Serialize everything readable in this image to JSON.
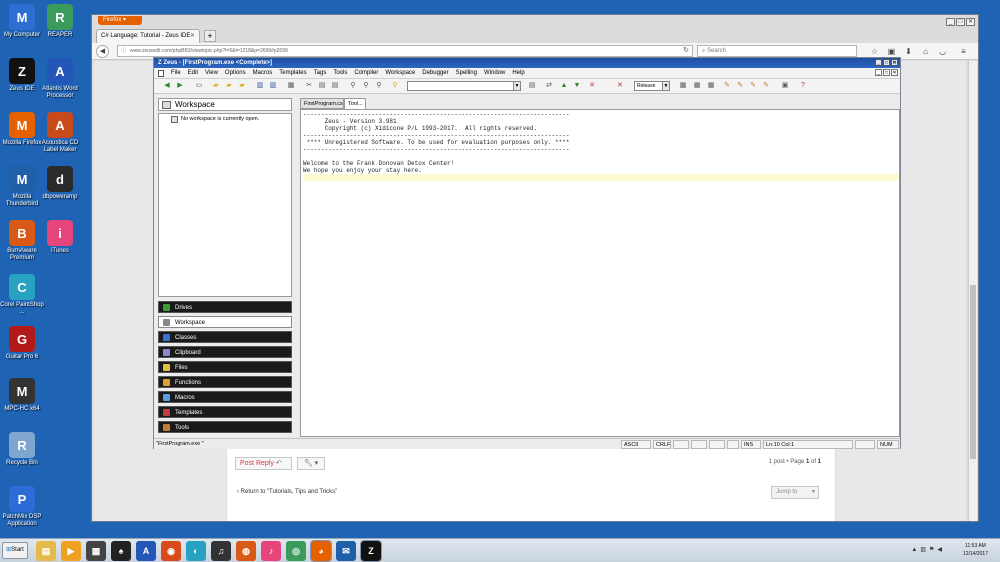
{
  "desktop": {
    "icons": [
      {
        "label": "My Computer",
        "color": "#2a6fd1"
      },
      {
        "label": "REAPER",
        "color": "#3b9b5c"
      },
      {
        "label": "Zeus IDE",
        "color": "#111111"
      },
      {
        "label": "Atlantis Word Processor",
        "color": "#2456b8"
      },
      {
        "label": "Mozilla Firefox",
        "color": "#e66000"
      },
      {
        "label": "Acoustica CD Label Maker",
        "color": "#c84a1a"
      },
      {
        "label": "Mozilla Thunderbird",
        "color": "#1f5fa8"
      },
      {
        "label": "dbpoweramp",
        "color": "#2b2b2b"
      },
      {
        "label": "BurnAware Premium",
        "color": "#d95a17"
      },
      {
        "label": "iTunes",
        "color": "#e5457b"
      },
      {
        "label": "Corel PaintShop ...",
        "color": "#27a3c1"
      },
      {
        "label": "Guitar Pro 6",
        "color": "#b21a1a"
      },
      {
        "label": "MPC-HC x64",
        "color": "#333333"
      },
      {
        "label": "Recycle Bin",
        "color": "#7fa6cf"
      },
      {
        "label": "PatchMix DSP Application",
        "color": "#2c6cd6"
      }
    ]
  },
  "firefox": {
    "menu_button": "Firefox",
    "tab_title": "C# Language: Tutorial - Zeus IDE",
    "new_tab": "+",
    "url": "www.zeusedit.com/phpBB3/viewtopic.php?f=5&t=1218&p=2699#p2699",
    "search_placeholder": "Search",
    "page": {
      "post_reply": "Post Reply",
      "post_count_prefix": "1 post • Page ",
      "page_current": "1",
      "page_sep": " of ",
      "page_total": "1",
      "back_link": "Return to “Tutorials, Tips and Tricks”",
      "jump_to": "Jump to"
    }
  },
  "zeus": {
    "title": "Zeus - [FirstProgram.exe  <Complete>]",
    "menu": [
      "File",
      "Edit",
      "View",
      "Options",
      "Macros",
      "Templates",
      "Tags",
      "Tools",
      "Compiler",
      "Workspace",
      "Debugger",
      "Spelling",
      "Window",
      "Help"
    ],
    "config_combo": "Release",
    "workspace": {
      "header": "Workspace",
      "tree_item": "No workspace is currently open.",
      "panels": [
        {
          "label": "Drives",
          "active": false,
          "icon_color": "#3a9d3a"
        },
        {
          "label": "Workspace",
          "active": true,
          "icon_color": "#888888"
        },
        {
          "label": "Classes",
          "active": false,
          "icon_color": "#3b6fd1"
        },
        {
          "label": "Clipboard",
          "active": false,
          "icon_color": "#8888cc"
        },
        {
          "label": "Files",
          "active": false,
          "icon_color": "#e0c040"
        },
        {
          "label": "Functions",
          "active": false,
          "icon_color": "#e0a030"
        },
        {
          "label": "Macros",
          "active": false,
          "icon_color": "#5aa0e0"
        },
        {
          "label": "Templates",
          "active": false,
          "icon_color": "#c04040"
        },
        {
          "label": "Tools",
          "active": false,
          "icon_color": "#c08030"
        }
      ]
    },
    "tabs": [
      {
        "label": "FirstProgram.cs"
      },
      {
        "label": "Tool..."
      }
    ],
    "editor_lines": [
      "--------------------------------------------------------------------------",
      "      Zeus - Version 3.981",
      "      Copyright (c) Xidicone P/L 1993-2017.  All rights reserved.",
      "--------------------------------------------------------------------------",
      " **** Unregistered Software. To be used for evaluation purposes only. ****",
      "--------------------------------------------------------------------------",
      "",
      "Welcome to the Frank Donovan Detox Center!",
      "We hope you enjoy your stay here.",
      ""
    ],
    "status": {
      "file": "\"FirstProgram.exe \"",
      "encoding": "ASCII",
      "eol": "CRLF",
      "mode": "INS",
      "position": "Ln:10 Col:1",
      "numlock": "NUM"
    }
  },
  "taskbar": {
    "start": "Start",
    "items": [
      {
        "name": "explorer",
        "color": "#e5b94a",
        "glyph": "▤"
      },
      {
        "name": "media-player",
        "color": "#f0a020",
        "glyph": "▶"
      },
      {
        "name": "mpc-hc",
        "color": "#444444",
        "glyph": "▦"
      },
      {
        "name": "guitar-pro",
        "color": "#222222",
        "glyph": "♠"
      },
      {
        "name": "atlantis",
        "color": "#2456b8",
        "glyph": "A"
      },
      {
        "name": "acoustica",
        "color": "#d94a1a",
        "glyph": "◉"
      },
      {
        "name": "paintshop",
        "color": "#27a3c1",
        "glyph": "◐"
      },
      {
        "name": "dbpoweramp",
        "color": "#333333",
        "glyph": "♫"
      },
      {
        "name": "burnaware",
        "color": "#d95a17",
        "glyph": "◍"
      },
      {
        "name": "itunes",
        "color": "#e5457b",
        "glyph": "♪"
      },
      {
        "name": "reaper",
        "color": "#3b9b5c",
        "glyph": "◎"
      },
      {
        "name": "firefox",
        "color": "#e66000",
        "glyph": "◕"
      },
      {
        "name": "thunderbird",
        "color": "#1f5fa8",
        "glyph": "✉"
      },
      {
        "name": "zeus",
        "color": "#111111",
        "glyph": "Z"
      }
    ],
    "time": "11:53 AM",
    "date": "12/14/2017"
  }
}
